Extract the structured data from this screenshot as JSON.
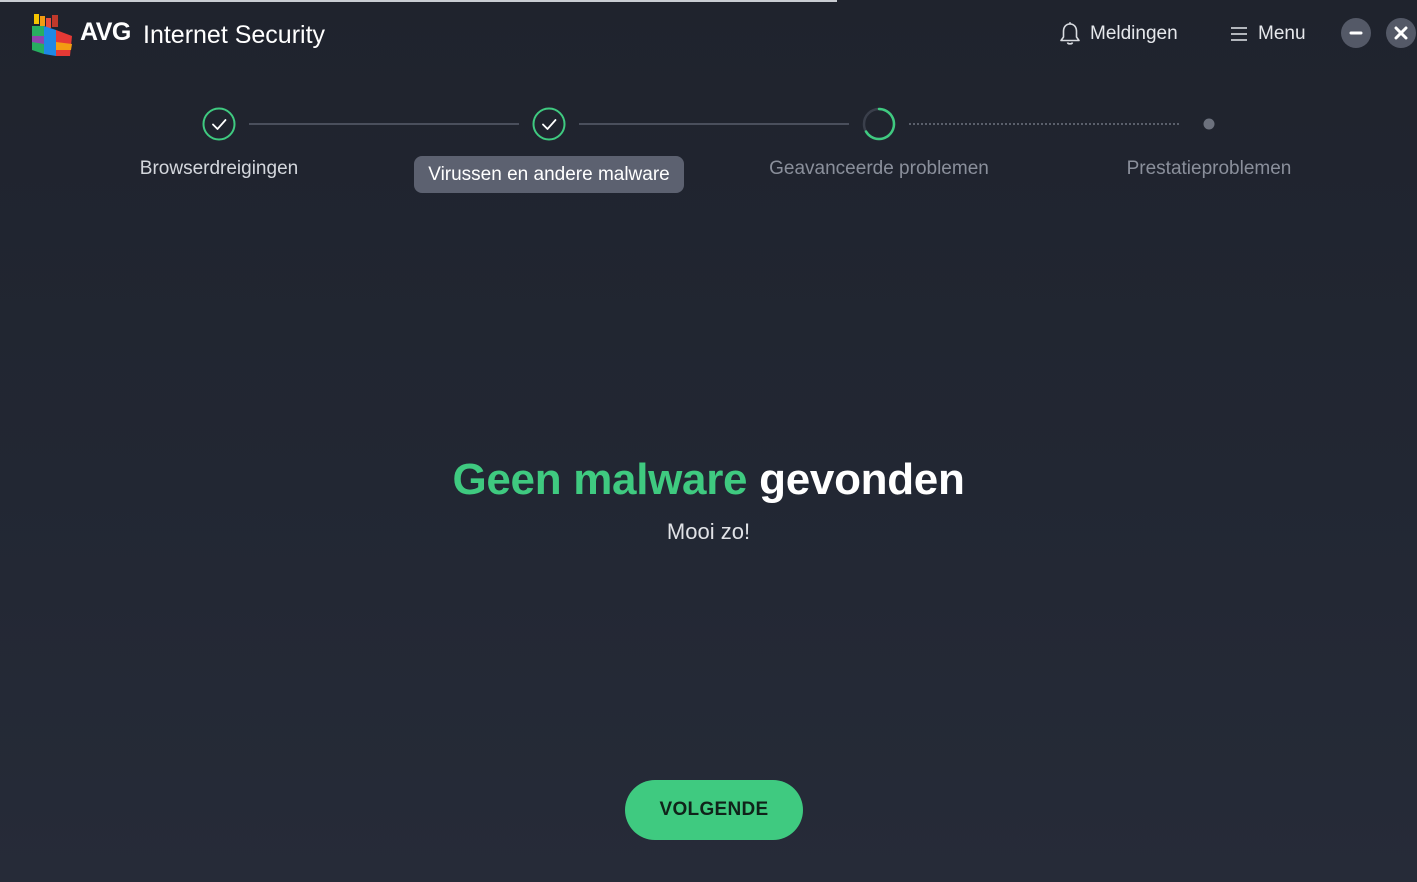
{
  "app": {
    "brand": "AVG",
    "product": "Internet Security"
  },
  "header": {
    "notifications_label": "Meldingen",
    "menu_label": "Menu"
  },
  "window_controls": {
    "minimize_icon": "minimize-icon",
    "close_icon": "close-icon"
  },
  "steps": [
    {
      "label": "Browserdreigingen",
      "status": "completed"
    },
    {
      "label": "Virussen en andere malware",
      "status": "completed-selected"
    },
    {
      "label": "Geavanceerde problemen",
      "status": "in-progress"
    },
    {
      "label": "Prestatieproblemen",
      "status": "pending"
    }
  ],
  "result": {
    "headline_green": "Geen malware",
    "headline_white": "gevonden",
    "subtitle": "Mooi zo!"
  },
  "actions": {
    "next_label": "VOLGENDE"
  },
  "colors": {
    "accent_green": "#3fca80",
    "background": "#222733",
    "active_step_bg": "#5c6170"
  }
}
